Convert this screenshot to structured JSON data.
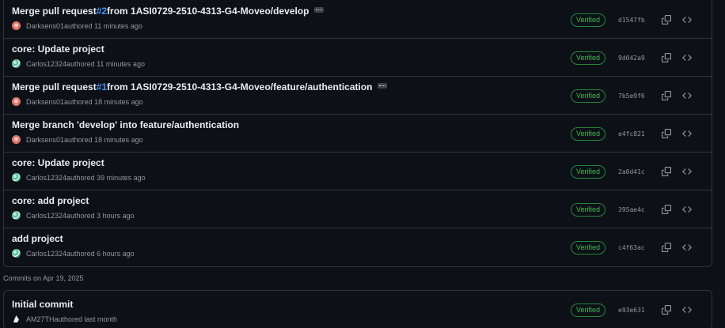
{
  "groups": [
    {
      "commits": [
        {
          "title_pre": "Merge pull request ",
          "pr": "#2",
          "title_post": " from 1ASI0729-2510-4313-G4-Moveo/develop",
          "has_ellipsis": true,
          "author": "Darksens01",
          "avatar": "darksens",
          "meta_suffix": " authored 11 minutes ago",
          "verified": "Verified",
          "sha": "d1547fb"
        },
        {
          "title_pre": "core: Update project",
          "pr": "",
          "title_post": "",
          "has_ellipsis": false,
          "author": "Carlos12324",
          "avatar": "carlos",
          "meta_suffix": " authored 11 minutes ago",
          "verified": "Verified",
          "sha": "9d042a9"
        },
        {
          "title_pre": "Merge pull request ",
          "pr": "#1",
          "title_post": " from 1ASI0729-2510-4313-G4-Moveo/feature/authentication",
          "has_ellipsis": true,
          "author": "Darksens01",
          "avatar": "darksens",
          "meta_suffix": " authored 18 minutes ago",
          "verified": "Verified",
          "sha": "7b5e9f6"
        },
        {
          "title_pre": "Merge branch 'develop' into feature/authentication",
          "pr": "",
          "title_post": "",
          "has_ellipsis": false,
          "author": "Darksens01",
          "avatar": "darksens",
          "meta_suffix": " authored 18 minutes ago",
          "verified": "Verified",
          "sha": "e4fc821"
        },
        {
          "title_pre": "core: Update project",
          "pr": "",
          "title_post": "",
          "has_ellipsis": false,
          "author": "Carlos12324",
          "avatar": "carlos",
          "meta_suffix": " authored 39 minutes ago",
          "verified": "Verified",
          "sha": "2a0d41c"
        },
        {
          "title_pre": "core: add project",
          "pr": "",
          "title_post": "",
          "has_ellipsis": false,
          "author": "Carlos12324",
          "avatar": "carlos",
          "meta_suffix": " authored 3 hours ago",
          "verified": "Verified",
          "sha": "395ae4c"
        },
        {
          "title_pre": "add project",
          "pr": "",
          "title_post": "",
          "has_ellipsis": false,
          "author": "Carlos12324",
          "avatar": "carlos",
          "meta_suffix": " authored 6 hours ago",
          "verified": "Verified",
          "sha": "c4f63ac"
        }
      ]
    },
    {
      "heading": "Commits on Apr 19, 2025",
      "commits": [
        {
          "title_pre": "Initial commit",
          "pr": "",
          "title_post": "",
          "has_ellipsis": false,
          "author": "AM27TH",
          "avatar": "am27th",
          "meta_suffix": " authored last month",
          "verified": "Verified",
          "sha": "e93e631"
        }
      ]
    }
  ],
  "icons": {
    "copy": "copy-icon",
    "browse": "code-icon",
    "ellipsis": "ellipsis-icon"
  },
  "colors": {
    "background": "#0d1117",
    "border": "#30363d",
    "link": "#4493f8",
    "verified": "#3fb950",
    "muted": "#9198a1"
  }
}
